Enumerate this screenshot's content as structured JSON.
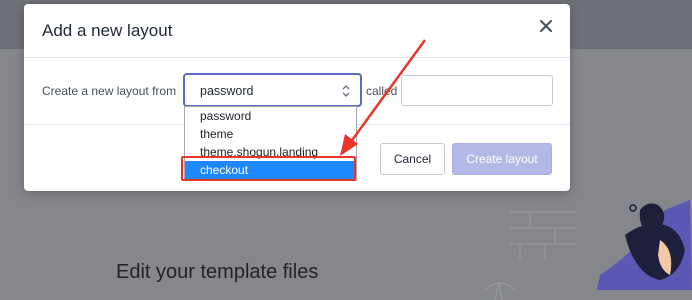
{
  "background": {
    "heading": "Edit your template files"
  },
  "modal": {
    "title": "Add a new layout",
    "create_label": "Create a new layout from",
    "selected_layout": "password",
    "called_label": "called",
    "name_input": {
      "value": "",
      "placeholder": ""
    },
    "cancel_label": "Cancel",
    "create_label_btn": "Create layout"
  },
  "dropdown": {
    "options": [
      "password",
      "theme",
      "theme.shogun.landing",
      "checkout"
    ],
    "highlighted": "checkout"
  },
  "colors": {
    "accent": "#5c6ac4",
    "annotation": "#e8342a",
    "selection": "#1e88ff"
  }
}
